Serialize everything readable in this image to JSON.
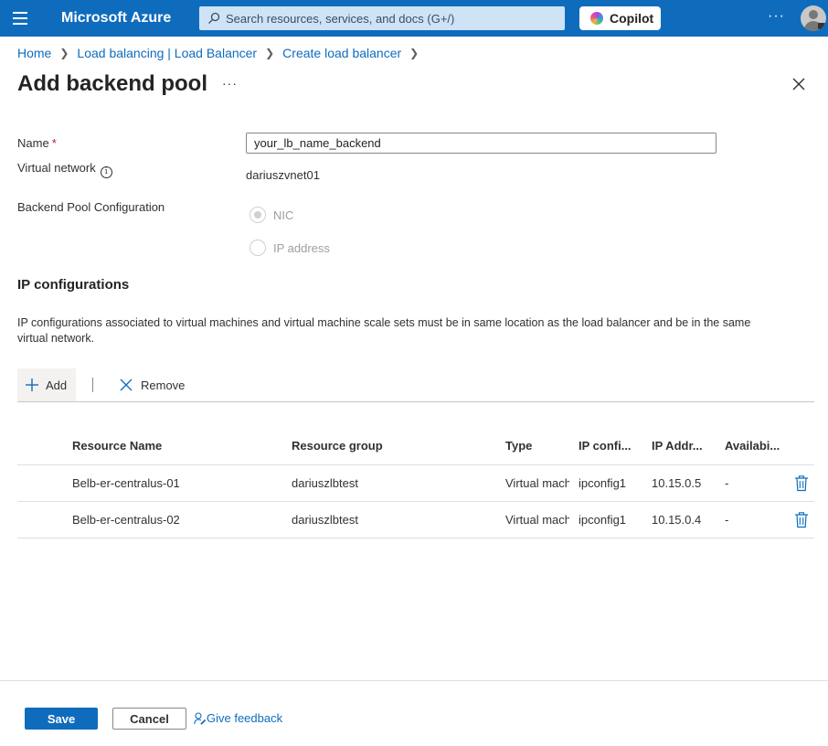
{
  "header": {
    "brand": "Microsoft Azure",
    "search_placeholder": "Search resources, services, and docs (G+/)",
    "copilot_label": "Copilot",
    "more_label": "···"
  },
  "breadcrumb": [
    "Home",
    "Load balancing | Load Balancer",
    "Create load balancer"
  ],
  "page": {
    "title": "Add backend pool",
    "more_label": "···"
  },
  "form": {
    "name_label": "Name",
    "name_required_mark": "*",
    "name_value": "your_lb_name_backend",
    "vnet_label": "Virtual network",
    "vnet_value": "dariuszvnet01",
    "pool_config_label": "Backend Pool Configuration",
    "options": [
      {
        "label": "NIC",
        "selected": true,
        "disabled": true
      },
      {
        "label": "IP address",
        "selected": false,
        "disabled": true
      }
    ]
  },
  "ip_configs": {
    "title": "IP configurations",
    "description": "IP configurations associated to virtual machines and virtual machine scale sets must be in same location as the load balancer and be in the same virtual network.",
    "toolbar": {
      "add_label": "Add",
      "remove_label": "Remove"
    },
    "columns": [
      "Resource Name",
      "Resource group",
      "Type",
      "IP confi...",
      "IP Addr...",
      "Availabi..."
    ],
    "rows": [
      [
        "Belb-er-centralus-01",
        "dariuszlbtest",
        "Virtual mach",
        "ipconfig1",
        "10.15.0.5",
        "-"
      ],
      [
        "Belb-er-centralus-02",
        "dariuszlbtest",
        "Virtual mach",
        "ipconfig1",
        "10.15.0.4",
        "-"
      ]
    ]
  },
  "footer": {
    "save_label": "Save",
    "cancel_label": "Cancel",
    "feedback_label": "Give feedback"
  },
  "colors": {
    "accent": "#0f6cbd",
    "required": "#a4262c"
  }
}
